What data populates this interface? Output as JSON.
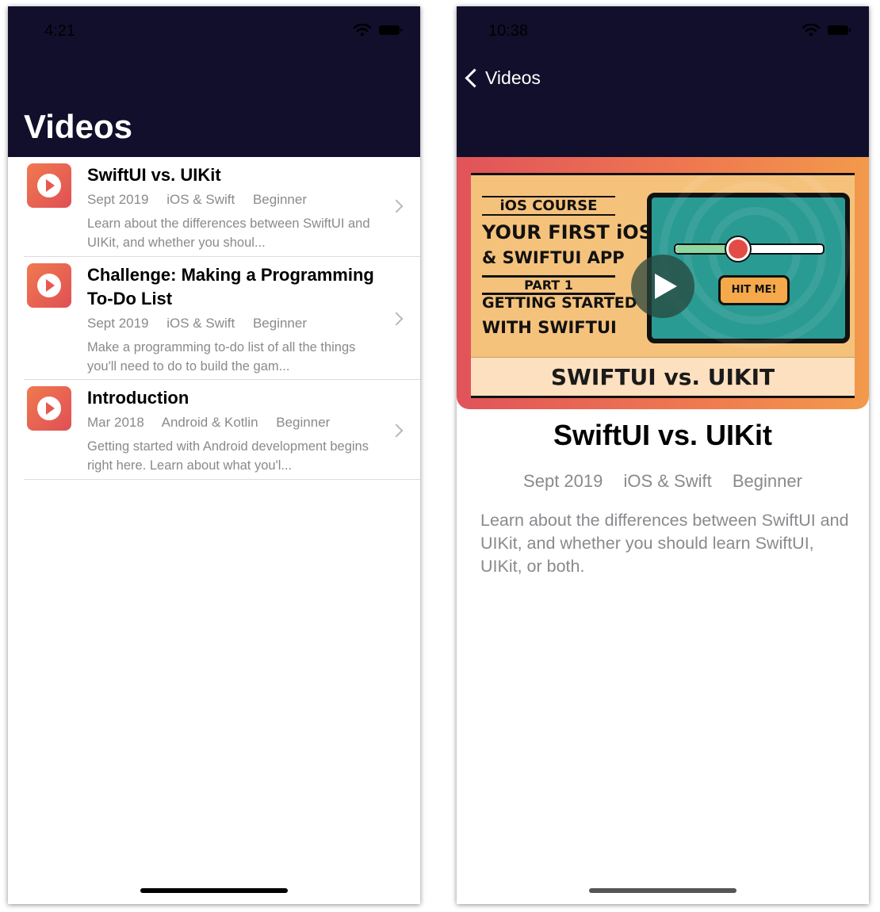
{
  "left_screen": {
    "status": {
      "time": "4:21"
    },
    "nav": {
      "title": "Videos"
    },
    "videos": [
      {
        "title": "SwiftUI vs. UIKit",
        "date": "Sept 2019",
        "platform": "iOS & Swift",
        "level": "Beginner",
        "description": "Learn about the differences between SwiftUI and UIKit, and whether you shoul..."
      },
      {
        "title": "Challenge: Making a Programming To-Do List",
        "date": "Sept 2019",
        "platform": "iOS & Swift",
        "level": "Beginner",
        "description": "Make a programming to-do list of all the things you'll need to do to build the gam..."
      },
      {
        "title": "Introduction",
        "date": "Mar 2018",
        "platform": "Android & Kotlin",
        "level": "Beginner",
        "description": "Getting started with Android development begins right here. Learn about what you'l..."
      }
    ]
  },
  "right_screen": {
    "status": {
      "time": "10:38"
    },
    "nav": {
      "back_label": "Videos"
    },
    "thumbnail": {
      "course_label": "iOS COURSE",
      "line1": "YOUR FIRST iOS",
      "line2": "& SWIFTUI APP",
      "part": "PART 1",
      "line3": "GETTING STARTED",
      "line4": "WITH SWIFTUI",
      "button_label": "HIT ME!",
      "banner": "SWIFTUI vs. UIKIT"
    },
    "detail": {
      "title": "SwiftUI vs. UIKit",
      "date": "Sept 2019",
      "platform": "iOS & Swift",
      "level": "Beginner",
      "description": "Learn about the differences between SwiftUI and UIKit, and whether you should learn SwiftUI, UIKit, or both."
    }
  },
  "colors": {
    "nav_background": "#110f2b",
    "accent_gradient_start": "#e0535a",
    "accent_gradient_end": "#f29a4c",
    "secondary_text": "#8a8a8e"
  },
  "icons": {
    "row_icon": "play-circle-icon",
    "disclosure": "chevron-right-icon",
    "back": "chevron-left-icon",
    "wifi": "wifi-icon",
    "battery": "battery-icon",
    "play_overlay": "play-icon"
  }
}
